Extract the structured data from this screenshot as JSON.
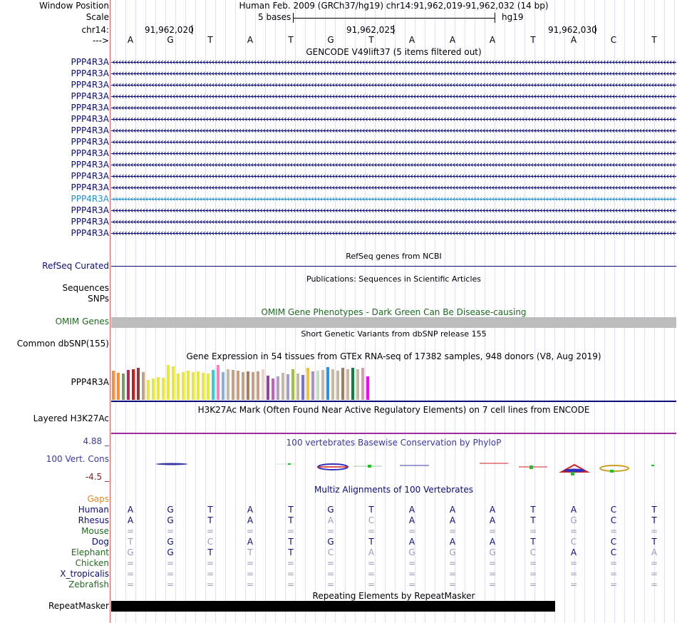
{
  "header": {
    "window_position_label": "Window Position",
    "scale_label": "Scale",
    "chrom_label": "chr14:",
    "strand_label": "--->",
    "assembly_text": "Human Feb. 2009 (GRCh37/hg19)   chr14:91,962,019-91,962,032 (14 bp)",
    "scale_text": "5 bases",
    "db_text": "hg19",
    "ruler_positions": [
      "91,962,020",
      "91,962,025",
      "91,962,030"
    ]
  },
  "sequence": [
    "A",
    "G",
    "T",
    "A",
    "T",
    "G",
    "T",
    "A",
    "A",
    "A",
    "T",
    "A",
    "C",
    "T"
  ],
  "gencode": {
    "title": "GENCODE V49lift37 (5 items filtered out)",
    "genes": [
      "PPP4R3A",
      "PPP4R3A",
      "PPP4R3A",
      "PPP4R3A",
      "PPP4R3A",
      "PPP4R3A",
      "PPP4R3A",
      "PPP4R3A",
      "PPP4R3A",
      "PPP4R3A",
      "PPP4R3A",
      "PPP4R3A",
      "PPP4R3A",
      "PPP4R3A",
      "PPP4R3A",
      "PPP4R3A"
    ],
    "highlight_index": 12,
    "gene_color": "#0c0c78",
    "highlight_color": "#1f8fd0"
  },
  "refseq": {
    "title": "RefSeq genes from NCBI",
    "label": "RefSeq Curated"
  },
  "publications": {
    "title": "Publications: Sequences in Scientific Articles",
    "label_line1": "Sequences",
    "label_line2": "SNPs"
  },
  "omim": {
    "title": "OMIM Gene Phenotypes - Dark Green Can Be Disease-causing",
    "label": "OMIM Genes",
    "color": "#1f6b1f"
  },
  "dbsnp": {
    "title": "Short Genetic Variants from dbSNP release 155",
    "label": "Common dbSNP(155)"
  },
  "gtex": {
    "title": "Gene Expression in 54 tissues from GTEx RNA-seq of 17382 samples, 948 donors (V8, Aug 2019)",
    "label": "PPP4R3A",
    "bars": [
      {
        "c": "#ff8c38",
        "v": 0.78
      },
      {
        "c": "#ff8c38",
        "v": 0.72
      },
      {
        "c": "#7a9a6a",
        "v": 0.7
      },
      {
        "c": "#b02a5a",
        "v": 0.8
      },
      {
        "c": "#d01818",
        "v": 0.82
      },
      {
        "c": "#8a3a3a",
        "v": 0.84
      },
      {
        "c": "#c8a080",
        "v": 0.74
      },
      {
        "c": "#e8e83a",
        "v": 0.52
      },
      {
        "c": "#e8e83a",
        "v": 0.56
      },
      {
        "c": "#e8e83a",
        "v": 0.6
      },
      {
        "c": "#e8e83a",
        "v": 0.58
      },
      {
        "c": "#e8e83a",
        "v": 0.92
      },
      {
        "c": "#e8e83a",
        "v": 0.88
      },
      {
        "c": "#e8e83a",
        "v": 0.7
      },
      {
        "c": "#e8e83a",
        "v": 0.74
      },
      {
        "c": "#e8e83a",
        "v": 0.78
      },
      {
        "c": "#e8e83a",
        "v": 0.74
      },
      {
        "c": "#e8e83a",
        "v": 0.76
      },
      {
        "c": "#e8e83a",
        "v": 0.72
      },
      {
        "c": "#e8e83a",
        "v": 0.7
      },
      {
        "c": "#33d0d0",
        "v": 0.8
      },
      {
        "c": "#ff80c0",
        "v": 0.92
      },
      {
        "c": "#8ab0e0",
        "v": 0.74
      },
      {
        "c": "#c8b8a0",
        "v": 0.82
      },
      {
        "c": "#c8a080",
        "v": 0.8
      },
      {
        "c": "#c8a080",
        "v": 0.78
      },
      {
        "c": "#c8a080",
        "v": 0.74
      },
      {
        "c": "#a08060",
        "v": 0.76
      },
      {
        "c": "#c8a080",
        "v": 0.74
      },
      {
        "c": "#c8a080",
        "v": 0.76
      },
      {
        "c": "#f0d0c8",
        "v": 0.82
      },
      {
        "c": "#8a4a9a",
        "v": 0.64
      },
      {
        "c": "#c060c0",
        "v": 0.56
      },
      {
        "c": "#b0a0c0",
        "v": 0.62
      },
      {
        "c": "#c8b8a0",
        "v": 0.72
      },
      {
        "c": "#a0a0c0",
        "v": 0.68
      },
      {
        "c": "#a0c040",
        "v": 0.82
      },
      {
        "c": "#c8b8a0",
        "v": 0.7
      },
      {
        "c": "#7070f0",
        "v": 0.66
      },
      {
        "c": "#f8c030",
        "v": 0.84
      },
      {
        "c": "#b090c0",
        "v": 0.76
      },
      {
        "c": "#c0e0c0",
        "v": 0.78
      },
      {
        "c": "#c8b8a0",
        "v": 0.8
      },
      {
        "c": "#3090e0",
        "v": 0.86
      },
      {
        "c": "#c8b8a0",
        "v": 0.82
      },
      {
        "c": "#c8b8a0",
        "v": 0.78
      },
      {
        "c": "#a08060",
        "v": 0.84
      },
      {
        "c": "#c8b8a0",
        "v": 0.82
      },
      {
        "c": "#108040",
        "v": 0.84
      },
      {
        "c": "#c8b8a0",
        "v": 0.82
      },
      {
        "c": "#d0a0b0",
        "v": 0.84
      },
      {
        "c": "#ff00ff",
        "v": 0.62
      }
    ]
  },
  "h3k27ac": {
    "title": "H3K27Ac Mark (Often Found Near Active Regulatory Elements) on 7 cell lines from ENCODE",
    "label": "Layered H3K27Ac"
  },
  "phylop": {
    "title": "100 vertebrates Basewise Conservation by PhyloP",
    "label": "100 Vert. Cons",
    "max_label": "4.88 _",
    "min_label": "-4.5 _",
    "color_title": "#3a3aa0",
    "color_min": "#8a1a1a",
    "color_max": "#8a4a1a"
  },
  "multiz": {
    "title": "Multiz Alignments of 100 Vertebrates",
    "gaps_label": "Gaps",
    "species": [
      {
        "name": "Human",
        "color": "#0c0c78",
        "row": [
          "A",
          "G",
          "T",
          "A",
          "T",
          "G",
          "T",
          "A",
          "A",
          "A",
          "T",
          "A",
          "C",
          "T"
        ]
      },
      {
        "name": "Rhesus",
        "color": "#0c0c78",
        "row": [
          "A",
          "G",
          "T",
          "A",
          "T",
          "A",
          "C",
          "A",
          "A",
          "A",
          "T",
          "G",
          "C",
          "T"
        ]
      },
      {
        "name": "Mouse",
        "color": "#1f6b1f",
        "row": [
          "=",
          "=",
          "=",
          "=",
          "=",
          "=",
          "=",
          "=",
          "=",
          "=",
          "=",
          "=",
          "=",
          "="
        ]
      },
      {
        "name": "Dog",
        "color": "#0c0c78",
        "row": [
          "T",
          "G",
          "C",
          "A",
          "T",
          "G",
          "T",
          "A",
          "A",
          "A",
          "T",
          "C",
          "C",
          "T"
        ]
      },
      {
        "name": "Elephant",
        "color": "#1f6b1f",
        "row": [
          "G",
          "G",
          "T",
          "T",
          "T",
          "C",
          "A",
          "G",
          "G",
          "G",
          "C",
          "A",
          "C",
          "A"
        ]
      },
      {
        "name": "Chicken",
        "color": "#1f6b1f",
        "row": [
          "=",
          "=",
          "=",
          "=",
          "=",
          "=",
          "=",
          "=",
          "=",
          "=",
          "=",
          "=",
          "=",
          "="
        ]
      },
      {
        "name": "X_tropicalis",
        "color": "#0c0c78",
        "row": [
          "=",
          "=",
          "=",
          "=",
          "=",
          "=",
          "=",
          "=",
          "=",
          "=",
          "=",
          "=",
          "=",
          "="
        ]
      },
      {
        "name": "Zebrafish",
        "color": "#1f6b1f",
        "row": [
          "=",
          "=",
          "=",
          "=",
          "=",
          "=",
          "=",
          "=",
          "=",
          "=",
          "=",
          "=",
          "=",
          "="
        ]
      }
    ]
  },
  "repeatmasker": {
    "title": "Repeating Elements by RepeatMasker",
    "label": "RepeatMasker"
  },
  "colors": {
    "gridline": "#dfe0f0",
    "left_border": "#d65f5f",
    "navy": "#0c0c78",
    "gaps_orange": "#e08a1a"
  }
}
